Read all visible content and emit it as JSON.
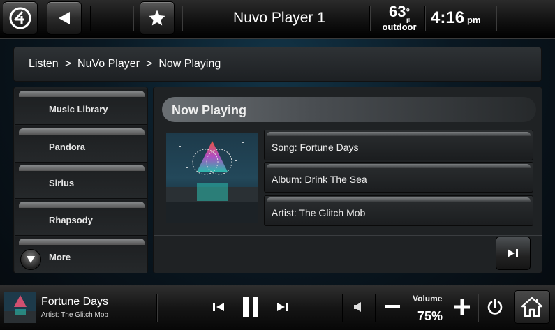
{
  "topbar": {
    "title": "Nuvo Player 1",
    "temperature": "63",
    "temperature_unit": "F",
    "temperature_degree": "°",
    "weather_label": "outdoor",
    "time": "4:16",
    "ampm": "pm",
    "icons": [
      "app-logo-icon",
      "back-arrow-icon",
      "star-icon"
    ]
  },
  "breadcrumb": {
    "items": [
      "Listen",
      "NuVo Player",
      "Now Playing"
    ],
    "separator": ">"
  },
  "sidebar": {
    "items": [
      {
        "label": "Music Library"
      },
      {
        "label": "Pandora"
      },
      {
        "label": "Sirius"
      },
      {
        "label": "Rhapsody"
      },
      {
        "label": "More"
      }
    ]
  },
  "now_playing": {
    "header": "Now Playing",
    "song": "Song: Fortune Days",
    "album": "Album: Drink The Sea",
    "artist": "Artist: The Glitch Mob"
  },
  "bottom_bar": {
    "song": "Fortune Days",
    "artist_line": "Artist: The Glitch Mob",
    "volume_label": "Volume",
    "volume_value": "75%",
    "icons": [
      "previous-track-icon",
      "pause-icon",
      "next-track-icon",
      "speaker-icon",
      "minus-icon",
      "plus-icon",
      "power-icon",
      "home-icon"
    ]
  },
  "colors": {
    "background": "#0a1822",
    "panel": "#1f2224",
    "accent_tab": "#8b8e90"
  }
}
